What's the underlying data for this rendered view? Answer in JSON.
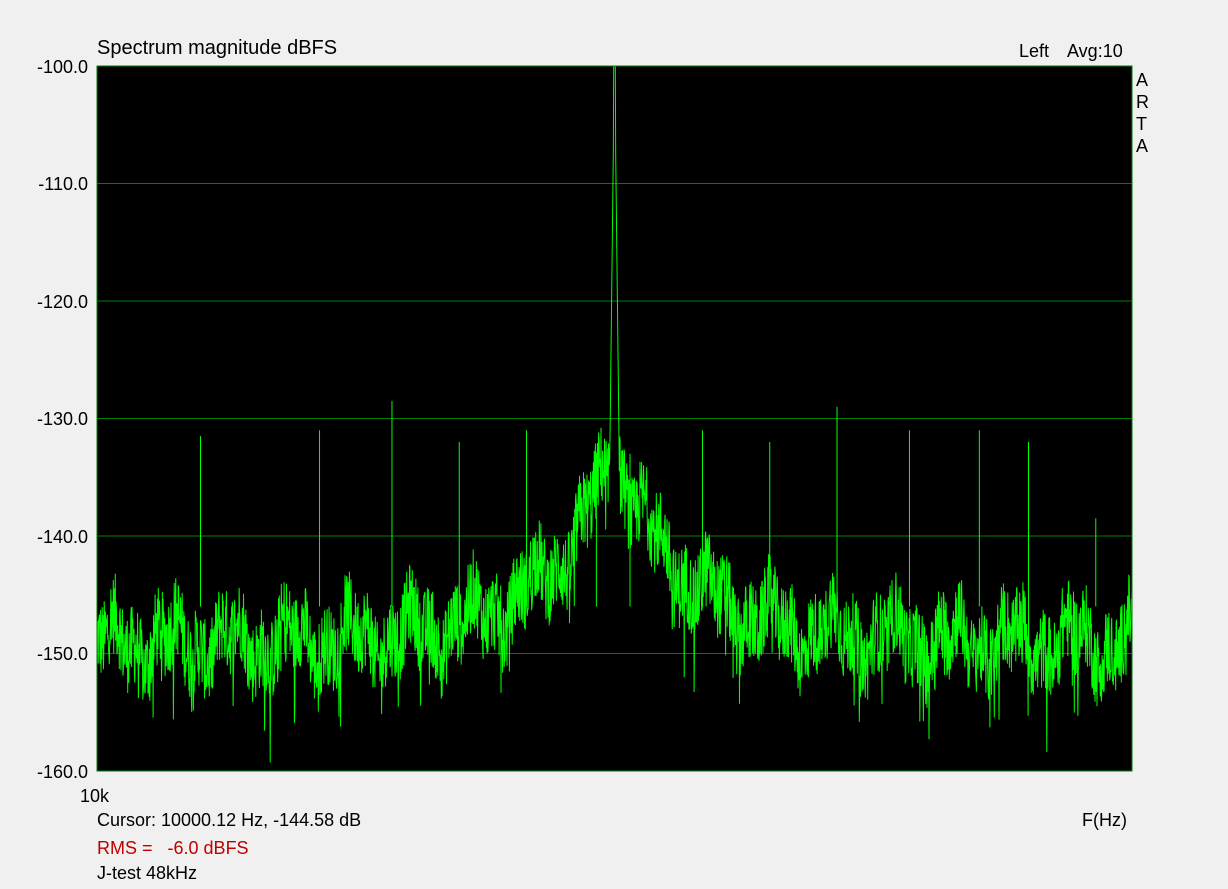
{
  "chart_data": {
    "type": "line",
    "title": "Spectrum magnitude dBFS",
    "ylabel": "",
    "xlabel": "F(Hz)",
    "ylim": [
      -160,
      -100
    ],
    "y_ticks": [
      "-100.0",
      "-110.0",
      "-120.0",
      "-130.0",
      "-140.0",
      "-150.0",
      "-160.0"
    ],
    "x_tick_labels": [
      "10k"
    ],
    "xlim_hz": [
      10000,
      14000
    ],
    "grid": true,
    "background_color": "#000000",
    "grid_color": "#008000",
    "line_color": "#00ff00",
    "series": [
      {
        "name": "",
        "description_values": "FFT spectrum, noise floor approx -149 dB at edges rising to -133 dB near central peak",
        "peak": {
          "x_hz": 12000,
          "y_db": -100
        },
        "spurs": [
          {
            "x_hz": 10400,
            "y_db": -131.5
          },
          {
            "x_hz": 10860,
            "y_db": -131
          },
          {
            "x_hz": 11140,
            "y_db": -128.5
          },
          {
            "x_hz": 11400,
            "y_db": -132
          },
          {
            "x_hz": 11660,
            "y_db": -131
          },
          {
            "x_hz": 11930,
            "y_db": -133
          },
          {
            "x_hz": 12060,
            "y_db": -133
          },
          {
            "x_hz": 12340,
            "y_db": -131
          },
          {
            "x_hz": 12600,
            "y_db": -132
          },
          {
            "x_hz": 12860,
            "y_db": -129
          },
          {
            "x_hz": 13140,
            "y_db": -131
          },
          {
            "x_hz": 13410,
            "y_db": -131
          },
          {
            "x_hz": 13600,
            "y_db": -132
          },
          {
            "x_hz": 13860,
            "y_db": -138.5
          }
        ]
      }
    ]
  },
  "header": {
    "channel": "Left",
    "averaging": "Avg:10",
    "brand": "ARTA"
  },
  "footer": {
    "cursor": "Cursor: 10000.12 Hz, -144.58 dB",
    "rms_label": "RMS =",
    "rms_value": "-6.0 dBFS",
    "test_name": "J-test 48kHz"
  }
}
